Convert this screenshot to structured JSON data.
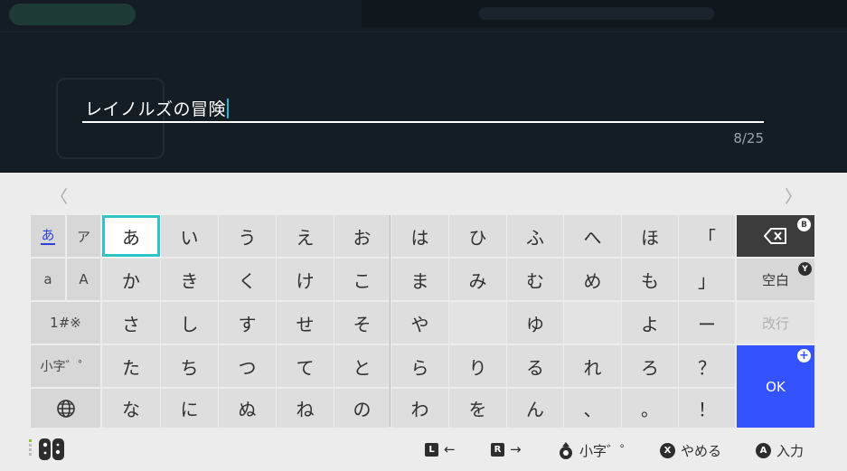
{
  "input": {
    "text": "レイノルズの冒険",
    "count": "8/25"
  },
  "nav": {
    "prev_icon": "chevron-left-icon",
    "next_icon": "chevron-right-icon",
    "prev_glyph": "〈",
    "next_glyph": "〉"
  },
  "modes": {
    "hiragana": "あ",
    "katakana": "ア",
    "lower": "a",
    "upper": "A",
    "symbols": "1#※",
    "small": "小字゛゜",
    "globe_icon": "globe-icon"
  },
  "keys": [
    [
      "あ",
      "い",
      "う",
      "え",
      "お",
      "は",
      "ひ",
      "ふ",
      "へ",
      "ほ",
      "「"
    ],
    [
      "か",
      "き",
      "く",
      "け",
      "こ",
      "ま",
      "み",
      "む",
      "め",
      "も",
      "」"
    ],
    [
      "さ",
      "し",
      "す",
      "せ",
      "そ",
      "や",
      "",
      "ゆ",
      "",
      "よ",
      "ー"
    ],
    [
      "た",
      "ち",
      "つ",
      "て",
      "と",
      "ら",
      "り",
      "る",
      "れ",
      "ろ",
      "？"
    ],
    [
      "な",
      "に",
      "ぬ",
      "ね",
      "の",
      "わ",
      "を",
      "ん",
      "、",
      "。",
      "！"
    ]
  ],
  "actions": {
    "backspace_icon": "backspace-icon",
    "backspace_badge": "B",
    "space": "空白",
    "space_badge": "Y",
    "newline": "改行",
    "ok": "OK",
    "ok_badge": "+"
  },
  "footer": {
    "l_button": "L",
    "l_arrow": "←",
    "r_button": "R",
    "r_arrow": "→",
    "stick_label": "小字゛゜",
    "x_button": "X",
    "x_label": "やめる",
    "a_button": "A",
    "a_label": "入力"
  },
  "colors": {
    "accent_teal": "#2ec5c9",
    "ok_blue": "#3453ff",
    "caret": "#22b6d8"
  }
}
